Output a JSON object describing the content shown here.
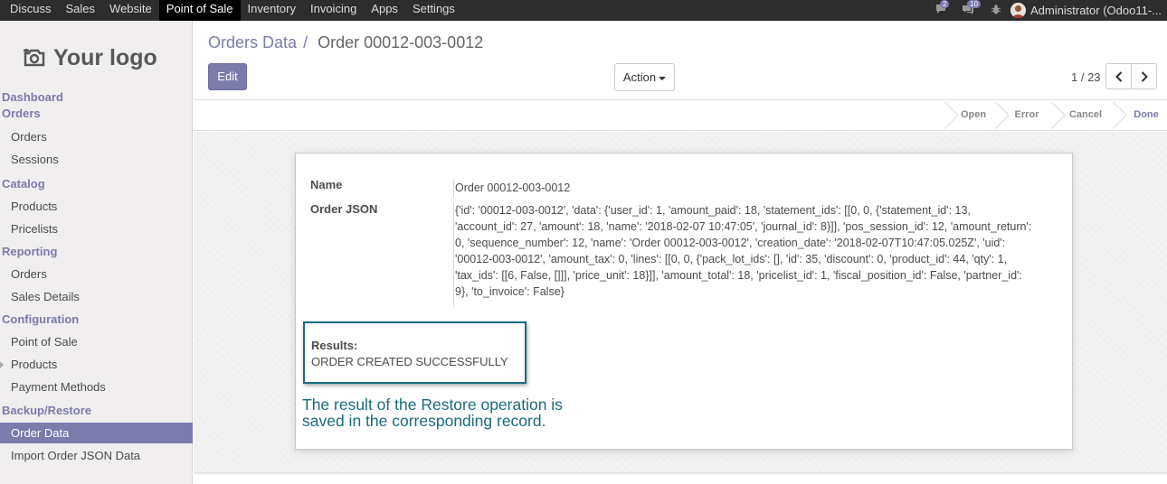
{
  "topbar": {
    "apps": [
      "Discuss",
      "Sales",
      "Website",
      "Point of Sale",
      "Inventory",
      "Invoicing",
      "Apps",
      "Settings"
    ],
    "active_app": "Point of Sale",
    "chat_badge": "2",
    "messages_badge": "10",
    "user_name": "Administrator (Odoo11-...",
    "icons": [
      "chat-icon",
      "messages-icon",
      "bug-icon",
      "user-avatar"
    ]
  },
  "sidebar": {
    "logo_text": "Your logo",
    "sections": [
      {
        "label": "Dashboard",
        "items": []
      },
      {
        "label": "Orders",
        "items": [
          "Orders",
          "Sessions"
        ]
      },
      {
        "label": "Catalog",
        "items": [
          "Products",
          "Pricelists"
        ]
      },
      {
        "label": "Reporting",
        "items": [
          "Orders",
          "Sales Details"
        ]
      },
      {
        "label": "Configuration",
        "items": [
          "Point of Sale",
          "Products",
          "Payment Methods"
        ]
      },
      {
        "label": "Backup/Restore",
        "items": [
          "Order Data",
          "Import Order JSON Data"
        ]
      }
    ],
    "active_item": "Order Data"
  },
  "control_panel": {
    "breadcrumb_parent": "Orders Data",
    "breadcrumb_separator": "/",
    "breadcrumb_current": "Order 00012-003-0012",
    "edit_label": "Edit",
    "action_label": "Action",
    "pager": "1 / 23"
  },
  "statusbar": {
    "stages": [
      "Open",
      "Error",
      "Cancel",
      "Done"
    ],
    "current_stage": "Done"
  },
  "form": {
    "name_label": "Name",
    "name_value": "Order 00012-003-0012",
    "json_label": "Order JSON",
    "json_value": "{'id': '00012-003-0012', 'data': {'user_id': 1, 'amount_paid': 18, 'statement_ids': [[0, 0, {'statement_id': 13, 'account_id': 27, 'amount': 18, 'name': '2018-02-07 10:47:05', 'journal_id': 8}]], 'pos_session_id': 12, 'amount_return': 0, 'sequence_number': 12, 'name': 'Order 00012-003-0012', 'creation_date': '2018-02-07T10:47:05.025Z', 'uid': '00012-003-0012', 'amount_tax': 0, 'lines': [[0, 0, {'pack_lot_ids': [], 'id': 35, 'discount': 0, 'product_id': 44, 'qty': 1, 'tax_ids': [[6, False, []]], 'price_unit': 18}]], 'amount_total': 18, 'pricelist_id': 1, 'fiscal_position_id': False, 'partner_id': 9}, 'to_invoice': False}",
    "results_label": "Results:",
    "results_value": "ORDER CREATED SUCCESSFULLY",
    "annotation_line1": "The result of the Restore operation is",
    "annotation_line2": "saved in the corresponding record."
  },
  "colors": {
    "accent": "#7c7bad",
    "topbar_bg": "#2d2d2d",
    "annotation": "#1a6a7e"
  }
}
